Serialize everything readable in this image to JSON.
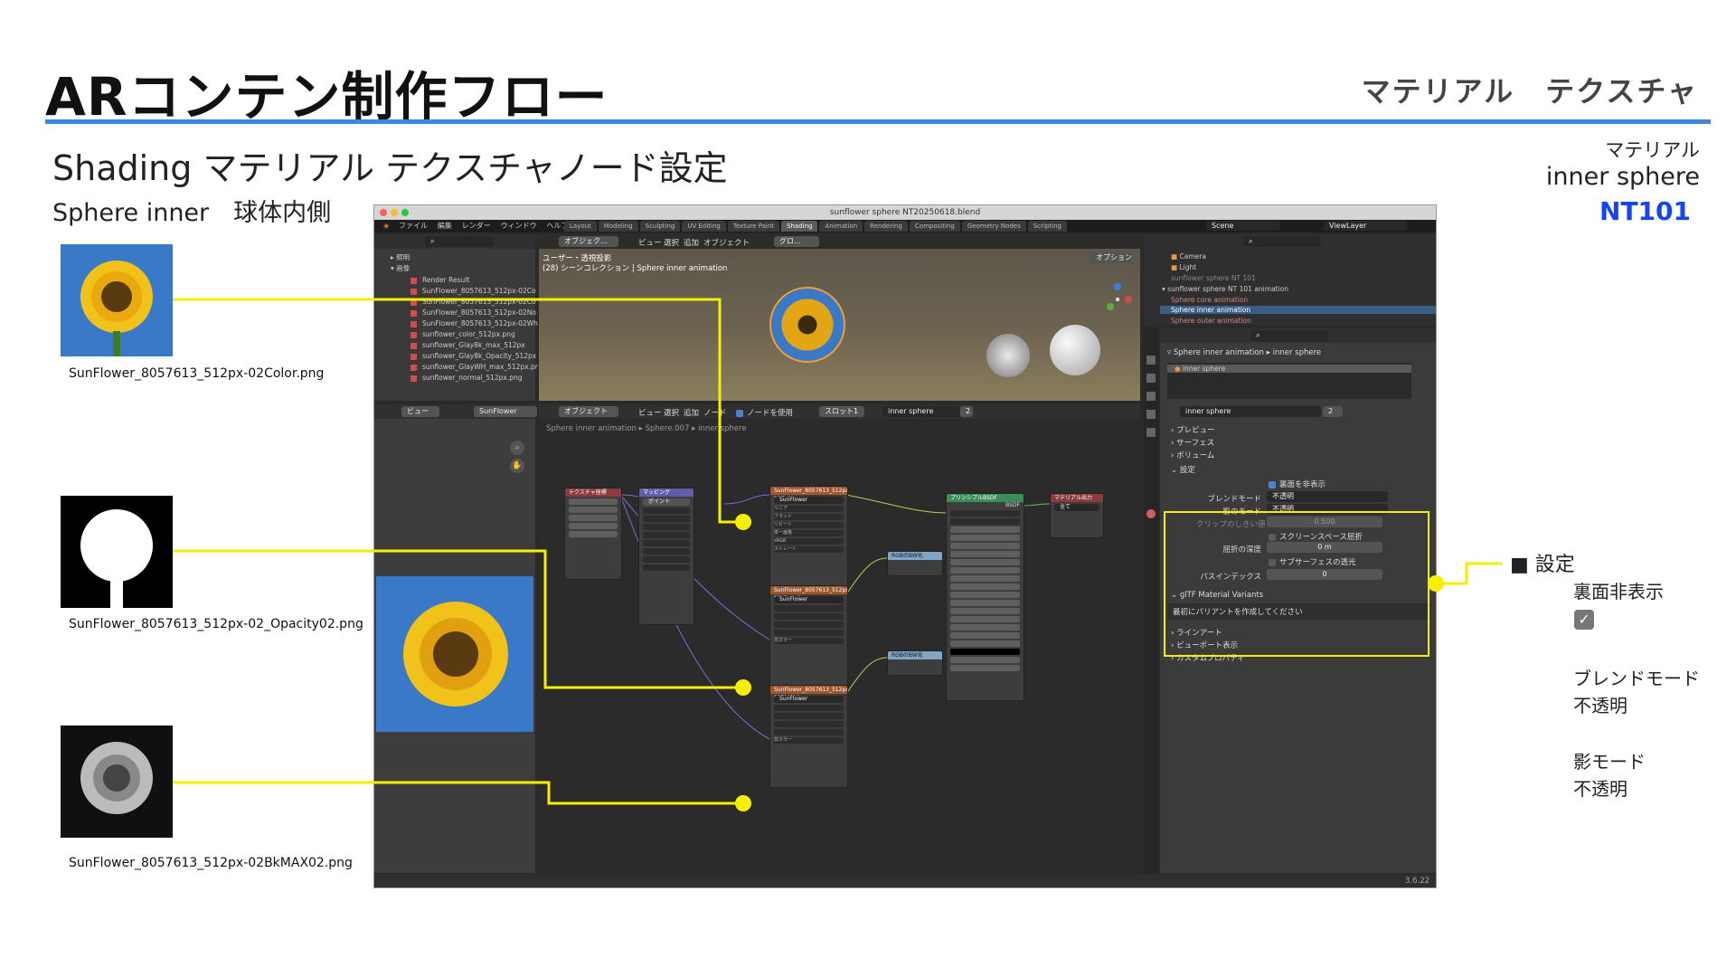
{
  "slide": {
    "title": "ARコンテン制作フロー",
    "title_right": "マテリアル　テクスチャ",
    "subtitle": "Shading マテリアル テクスチャノード設定",
    "subtitle2": "Sphere inner　球体内側",
    "material_label": "マテリアル",
    "material_name": "inner sphere",
    "material_code": "NT101",
    "accent": "#3e88d8",
    "code_color": "#1645f0",
    "callout_color": "#f6ef00"
  },
  "textures": [
    {
      "caption": "SunFlower_8057613_512px-02Color.png"
    },
    {
      "caption": "SunFlower_8057613_512px-02_Opacity02.png"
    },
    {
      "caption": "SunFlower_8057613_512px-02BkMAX02.png"
    }
  ],
  "notes": {
    "heading": "■ 設定",
    "backface": "裏面非表示",
    "blend_label": "ブレンドモード",
    "blend_value": "不透明",
    "shadow_label": "影モード",
    "shadow_value": "不透明"
  },
  "blender": {
    "window_title": "sunflower sphere NT20250618.blend",
    "menu": [
      "ファイル",
      "編集",
      "レンダー",
      "ウィンドウ",
      "ヘルプ"
    ],
    "workspaces": [
      "Layout",
      "Modeling",
      "Sculpting",
      "UV Editing",
      "Texture Paint",
      "Shading",
      "Animation",
      "Rendering",
      "Compositing",
      "Geometry Nodes",
      "Scripting"
    ],
    "active_workspace": "Shading",
    "scene": "Scene",
    "view_layer": "ViewLayer",
    "file_browser": {
      "folders": [
        "照明",
        "画像"
      ],
      "items": [
        "Render Result",
        "SunFlower_8057613_512px-02Co",
        "SunFlower_8057613_512px-02Co",
        "SunFlower_8057613_512px-02No",
        "SunFlower_8057613_512px-02Wh",
        "sunflower_color_512px.png",
        "sunflower_Glay8k_max_512px",
        "sunflower_Glay8k_Opacity_512px",
        "sunflower_GlayWH_max_512px.pr",
        "sunflower_normal_512px.png"
      ]
    },
    "image_editor": {
      "view": "ビュー",
      "image": "SunFlower"
    },
    "viewport": {
      "mode": "オブジェク...",
      "menus": [
        "ビュー",
        "選択",
        "追加",
        "オブジェクト"
      ],
      "global": "グロ...",
      "info_line1": "ユーザー・透視投影",
      "info_line2": "(28) シーンコレクション | Sphere inner animation",
      "options": "オプション"
    },
    "node_editor": {
      "mode": "オブジェクト",
      "menus": [
        "ビュー",
        "選択",
        "追加",
        "ノード"
      ],
      "use_nodes": "ノードを使用",
      "slot": "スロット1",
      "material": "inner sphere",
      "users": "2",
      "breadcrumb": [
        "Sphere inner animation",
        "Sphere.007",
        "inner sphere"
      ],
      "nodes": {
        "texcoord": "テクスチャ座標",
        "mapping": "マッピング",
        "mapping_type": "ポイント",
        "tex1": "SunFlower_8057613_512px-02Color.p...",
        "tex2": "SunFlower_8057613_512px-02_Opacity...",
        "tex3": "SunFlower_8057613_512px-02BkMAX...",
        "tex_image": "SunFlower",
        "tex_options": [
          "リニア",
          "フラット",
          "リピート",
          "単一画像"
        ],
        "colorspace_label": "色空間",
        "colorspace1": "sRGB",
        "colorspace2": "非カラー",
        "alpha_label": "アルファ",
        "alpha1": "ストレート",
        "rgb1": "RGBのBW化",
        "rgb2": "RGBのBW化",
        "bsdf": "プリンシプルBSDF",
        "bsdf_top": "BSDF",
        "output": "マテリアル出力",
        "output_target": "全て"
      }
    },
    "outliner": {
      "rows": [
        "Camera",
        "Light",
        "sunflower sphere NT 101",
        "sunflower sphere NT 101 animation",
        "Sphere core animation",
        "Sphere inner animation",
        "Sphere outer animation"
      ]
    },
    "properties": {
      "breadcrumb_object": "Sphere inner animation",
      "breadcrumb_material": "inner sphere",
      "slot_item": "inner sphere",
      "material_field": "inner sphere",
      "users": "2",
      "sections": [
        "プレビュー",
        "サーフェス",
        "ボリューム",
        "設定"
      ],
      "backface": "裏面を非表示",
      "blend_label": "ブレンドモード",
      "blend_value": "不透明",
      "shadow_label": "影のモード",
      "shadow_value": "不透明",
      "clip_label": "クリップのしきい値",
      "clip_value": "0.500",
      "screenspace": "スクリーンスペース屈折",
      "refraction_label": "屈折の深度",
      "refraction_value": "0 m",
      "subsurface": "サブサーフェスの透光",
      "pass_label": "パスインデックス",
      "pass_value": "0",
      "gltf": "glTF Material Variants",
      "gltf_hint": "最初にバリアントを作成してください",
      "more": [
        "ラインアート",
        "ビューポート表示",
        "カスタムプロパティ"
      ]
    },
    "version": "3.6.22"
  }
}
